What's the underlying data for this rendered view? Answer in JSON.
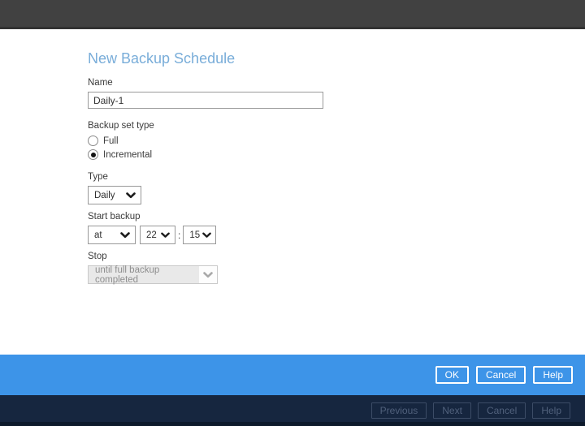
{
  "page": {
    "title": "New Backup Schedule"
  },
  "form": {
    "name": {
      "label": "Name",
      "value": "Daily-1"
    },
    "backup_set_type": {
      "label": "Backup set type",
      "options": [
        {
          "label": "Full",
          "selected": false
        },
        {
          "label": "Incremental",
          "selected": true
        }
      ]
    },
    "type": {
      "label": "Type",
      "value": "Daily"
    },
    "start_backup": {
      "label": "Start backup",
      "mode_value": "at",
      "hour_value": "22",
      "separator": ":",
      "minute_value": "15"
    },
    "stop": {
      "label": "Stop",
      "value": "until full backup completed",
      "disabled": true
    }
  },
  "action_bar": {
    "buttons": [
      {
        "label": "OK"
      },
      {
        "label": "Cancel"
      },
      {
        "label": "Help"
      }
    ]
  },
  "wizard_bar": {
    "buttons": [
      {
        "label": "Previous"
      },
      {
        "label": "Next"
      },
      {
        "label": "Cancel"
      },
      {
        "label": "Help"
      }
    ]
  },
  "icons": {
    "chevron_down": "chevron-down-icon"
  },
  "colors": {
    "top_bar": "#414141",
    "title_blue": "#79add9",
    "accent_blue": "#3d94e8",
    "navy": "#16263f",
    "disabled_gray": "#e9e9e9"
  }
}
